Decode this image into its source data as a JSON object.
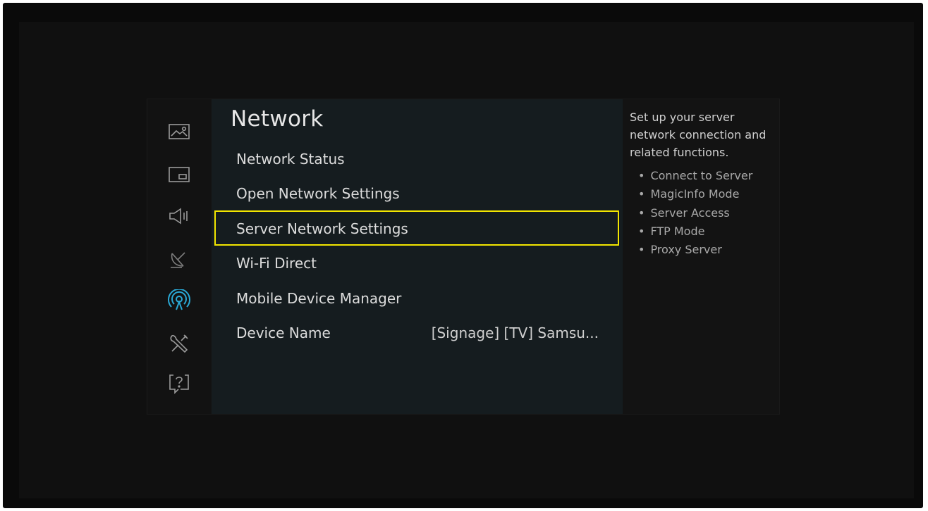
{
  "sidebar": {
    "icons": [
      {
        "name": "picture-icon"
      },
      {
        "name": "screen-layout-icon"
      },
      {
        "name": "sound-icon"
      },
      {
        "name": "broadcasting-icon"
      },
      {
        "name": "network-icon",
        "active": true
      },
      {
        "name": "tools-icon"
      },
      {
        "name": "help-icon"
      }
    ],
    "active_color": "#2aa9d6",
    "icon_color": "#9a9a9a"
  },
  "panel": {
    "title": "Network",
    "items": [
      {
        "label": "Network Status"
      },
      {
        "label": "Open Network Settings"
      },
      {
        "label": "Server Network Settings",
        "selected": true
      },
      {
        "label": "Wi-Fi Direct"
      },
      {
        "label": "Mobile Device Manager"
      },
      {
        "label": "Device Name",
        "value": "[Signage] [TV] Samsu..."
      }
    ]
  },
  "help": {
    "description": "Set up your server network connection and related functions.",
    "bullets": [
      "Connect to Server",
      "MagicInfo Mode",
      "Server Access",
      "FTP Mode",
      "Proxy Server"
    ]
  },
  "colors": {
    "selection_border": "#f2e600"
  }
}
